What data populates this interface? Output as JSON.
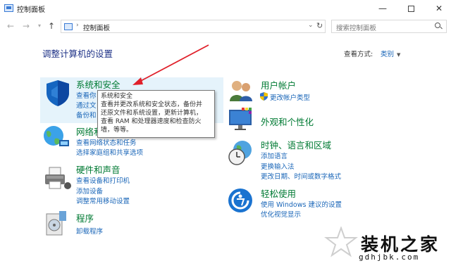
{
  "window": {
    "title": "控制面板"
  },
  "address": {
    "path": "控制面板",
    "search_placeholder": "搜索控制面板"
  },
  "main": {
    "heading": "调整计算机的设置",
    "viewby_label": "查看方式:",
    "viewby_value": "类别"
  },
  "categories": {
    "security": {
      "title": "系统和安全",
      "links": [
        "查看你",
        "通过文",
        "备份和"
      ]
    },
    "network": {
      "title": "网络和",
      "links": [
        "查看网络状态和任务",
        "选择家庭组和共享选项"
      ]
    },
    "hardware": {
      "title": "硬件和声音",
      "links": [
        "查看设备和打印机",
        "添加设备",
        "调整常用移动设置"
      ]
    },
    "programs": {
      "title": "程序",
      "links": [
        "卸载程序"
      ]
    },
    "users": {
      "title": "用户帐户",
      "links": [
        "更改帐户类型"
      ]
    },
    "appearance": {
      "title": "外观和个性化",
      "links": []
    },
    "clock": {
      "title": "时钟、语言和区域",
      "links": [
        "添加语言",
        "更换输入法",
        "更改日期、时间或数字格式"
      ]
    },
    "access": {
      "title": "轻松使用",
      "links": [
        "使用 Windows 建议的设置",
        "优化视觉显示"
      ]
    }
  },
  "tooltip": {
    "lines": [
      "系统和安全",
      "查看并更改系统和安全状态，备份并",
      "还原文件和系统设置，更新计算机，",
      "查看 RAM 和处理器速度和检查防火",
      "墙，等等。"
    ]
  },
  "watermark": {
    "text": "装机之家",
    "url": "gdhjbk.com"
  },
  "colors": {
    "category_title": "#007a33",
    "link": "#1a66b8",
    "heading": "#1e3287",
    "hover": "#e5f3fb",
    "arrow": "#e0202a"
  }
}
